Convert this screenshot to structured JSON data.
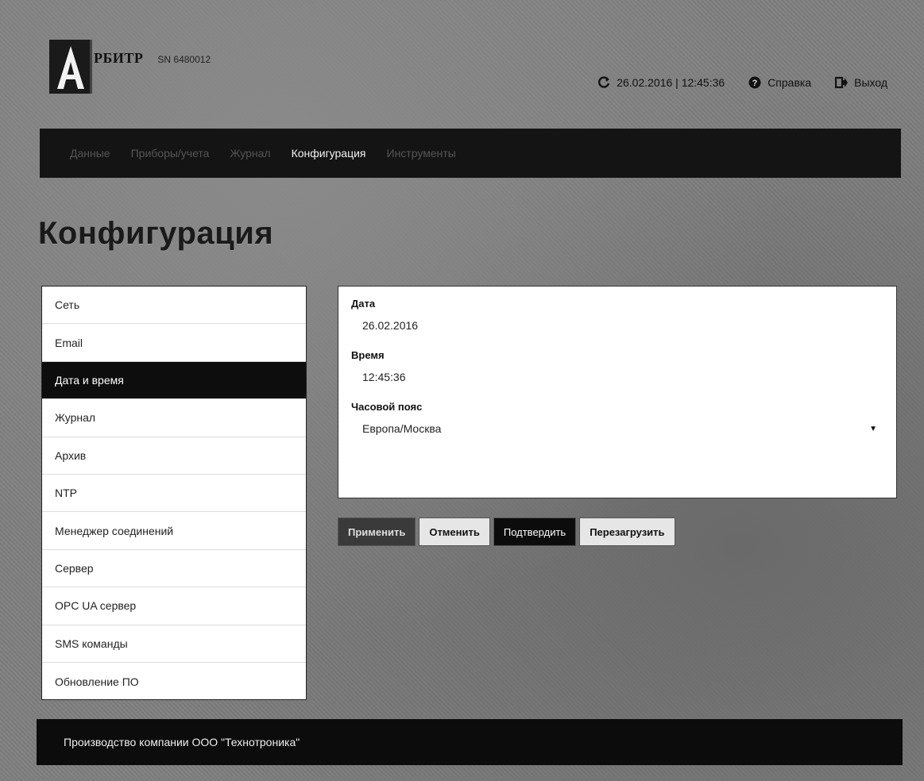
{
  "header": {
    "logo_text": "РБИТР",
    "serial": "SN 6480012",
    "datetime": "26.02.2016 | 12:45:36",
    "help_label": "Справка",
    "logout_label": "Выход"
  },
  "nav": {
    "items": [
      {
        "label": "Данные"
      },
      {
        "label": "Приборы/учета"
      },
      {
        "label": "Журнал"
      },
      {
        "label": "Конфигурация"
      },
      {
        "label": "Инструменты"
      }
    ]
  },
  "page": {
    "title": "Конфигурация"
  },
  "sidebar": {
    "items": [
      {
        "label": "Сеть"
      },
      {
        "label": "Email"
      },
      {
        "label": "Дата и время"
      },
      {
        "label": "Журнал"
      },
      {
        "label": "Архив"
      },
      {
        "label": "NTP"
      },
      {
        "label": "Менеджер соединений"
      },
      {
        "label": "Сервер"
      },
      {
        "label": "OPC UA сервер"
      },
      {
        "label": "SMS команды"
      },
      {
        "label": "Обновление ПО"
      }
    ]
  },
  "form": {
    "date_label": "Дата",
    "date_value": "26.02.2016",
    "time_label": "Время",
    "time_value": "12:45:36",
    "timezone_label": "Часовой пояс",
    "timezone_value": "Европа/Москва"
  },
  "buttons": {
    "apply": "Применить",
    "cancel": "Отменить",
    "confirm": "Подтвердить",
    "reload": "Перезагрузить"
  },
  "footer": {
    "text": "Производство компании ООО \"Технотроника\""
  }
}
